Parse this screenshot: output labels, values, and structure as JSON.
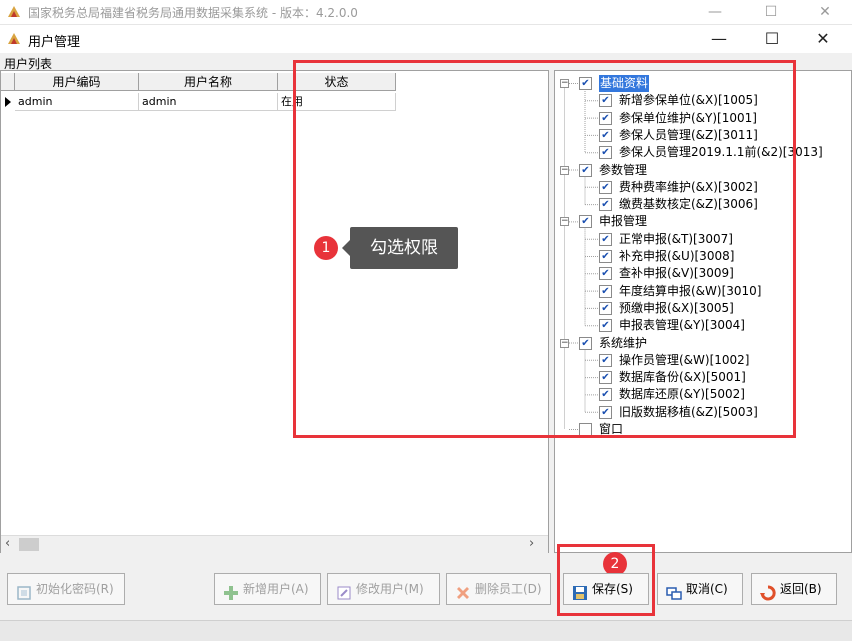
{
  "outer_window": {
    "title": "国家税务总局福建省税务局通用数据采集系统 - 版本：4.2.0.0",
    "controls": [
      "—",
      "☐",
      "✕"
    ]
  },
  "dialog": {
    "title": "用户管理",
    "controls": [
      "—",
      "☐",
      "✕"
    ]
  },
  "user_list": {
    "label": "用户列表",
    "columns": [
      "用户编码",
      "用户名称",
      "状态"
    ],
    "rows": [
      {
        "code": "admin",
        "name": "admin",
        "status": "在用"
      }
    ],
    "scroll_left": "‹",
    "scroll_right": "›"
  },
  "permission_tree": {
    "groups": [
      {
        "label": "基础资料",
        "checked": true,
        "selected": true,
        "items": [
          "新增参保单位(&X)[1005]",
          "参保单位维护(&Y)[1001]",
          "参保人员管理(&Z)[3011]",
          "参保人员管理2019.1.1前(&2)[3013]"
        ]
      },
      {
        "label": "参数管理",
        "checked": true,
        "items": [
          "费种费率维护(&X)[3002]",
          "缴费基数核定(&Z)[3006]"
        ]
      },
      {
        "label": "申报管理",
        "checked": true,
        "items": [
          "正常申报(&T)[3007]",
          "补充申报(&U)[3008]",
          "查补申报(&V)[3009]",
          "年度结算申报(&W)[3010]",
          "预缴申报(&X)[3005]",
          "申报表管理(&Y)[3004]"
        ]
      },
      {
        "label": "系统维护",
        "checked": true,
        "items": [
          "操作员管理(&W)[1002]",
          "数据库备份(&X)[5001]",
          "数据库还原(&Y)[5002]",
          "旧版数据移植(&Z)[5003]"
        ]
      },
      {
        "label": "窗口",
        "checked": false,
        "items": []
      }
    ]
  },
  "annotations": {
    "step1_number": "1",
    "step1_text": "勾选权限",
    "step2_number": "2",
    "highlight_color": "#e8333a"
  },
  "buttons": {
    "init_password": "初始化密码(R)",
    "add_user": "新增用户(A)",
    "edit_user": "修改用户(M)",
    "delete_user": "删除员工(D)",
    "save": "保存(S)",
    "cancel": "取消(C)",
    "back": "返回(B)"
  },
  "icons": {
    "app": "app-logo-icon",
    "dialog": "user-manage-icon",
    "init_password": "reset-icon",
    "add_user": "plus-icon",
    "edit_user": "edit-icon",
    "delete_user": "delete-x-icon",
    "save": "save-disk-icon",
    "cancel": "cancel-windows-icon",
    "back": "back-arrow-icon"
  }
}
